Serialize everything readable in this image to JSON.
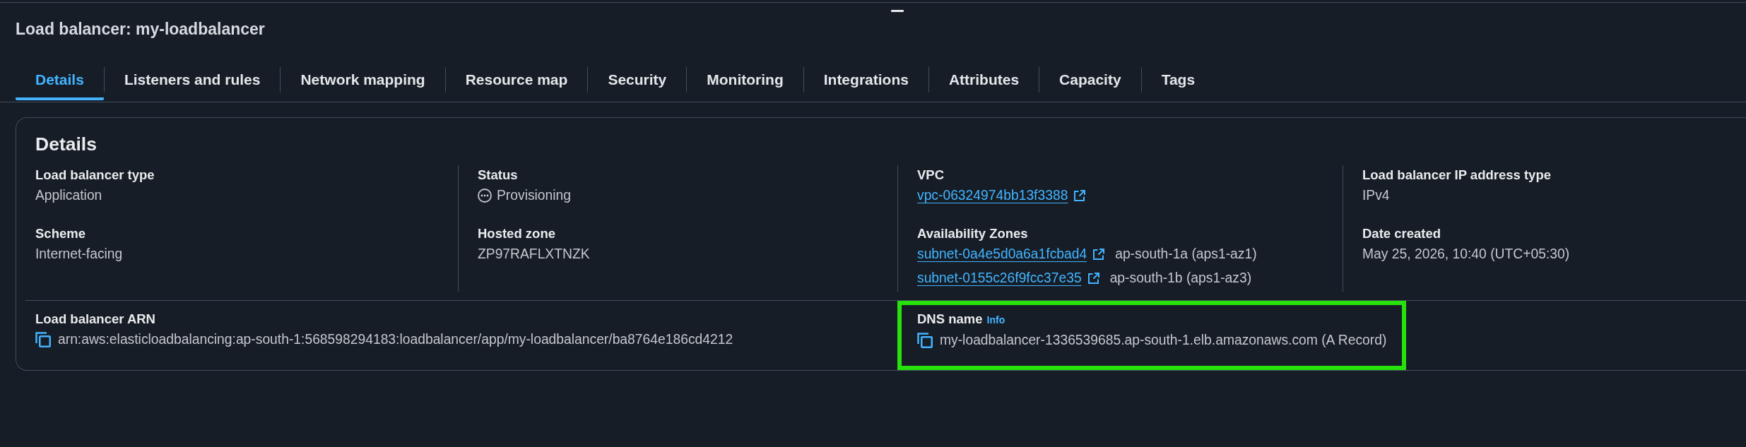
{
  "header": {
    "title": "Load balancer: my-loadbalancer"
  },
  "tabs": [
    {
      "label": "Details",
      "selected": true
    },
    {
      "label": "Listeners and rules",
      "selected": false
    },
    {
      "label": "Network mapping",
      "selected": false
    },
    {
      "label": "Resource map",
      "selected": false
    },
    {
      "label": "Security",
      "selected": false
    },
    {
      "label": "Monitoring",
      "selected": false
    },
    {
      "label": "Integrations",
      "selected": false
    },
    {
      "label": "Attributes",
      "selected": false
    },
    {
      "label": "Capacity",
      "selected": false
    },
    {
      "label": "Tags",
      "selected": false
    }
  ],
  "details": {
    "heading": "Details",
    "columns": [
      [
        {
          "label": "Load balancer type",
          "values": [
            {
              "kind": "text",
              "text": "Application"
            }
          ]
        },
        {
          "label": "Scheme",
          "values": [
            {
              "kind": "text",
              "text": "Internet-facing"
            }
          ]
        }
      ],
      [
        {
          "label": "Status",
          "values": [
            {
              "kind": "status",
              "pending": true,
              "text": "Provisioning"
            }
          ]
        },
        {
          "label": "Hosted zone",
          "values": [
            {
              "kind": "text",
              "text": "ZP97RAFLXTNZK"
            }
          ]
        }
      ],
      [
        {
          "label": "VPC",
          "values": [
            {
              "kind": "link",
              "text": "vpc-06324974bb13f3388"
            }
          ]
        },
        {
          "label": "Availability Zones",
          "values": [
            {
              "kind": "link",
              "text": "subnet-0a4e5d0a6a1fcbad4",
              "note": "ap-south-1a (aps1-az1)"
            },
            {
              "kind": "link",
              "text": "subnet-0155c26f9fcc37e35",
              "note": "ap-south-1b (aps1-az3)"
            }
          ]
        }
      ],
      [
        {
          "label": "Load balancer IP address type",
          "values": [
            {
              "kind": "text",
              "text": "IPv4"
            }
          ]
        },
        {
          "label": "Date created",
          "values": [
            {
              "kind": "text",
              "text": "May 25, 2026, 10:40 (UTC+05:30)"
            }
          ]
        }
      ]
    ],
    "footer": [
      {
        "label": "Load balancer ARN",
        "highlighted": false,
        "values": [
          {
            "kind": "copy",
            "text": "arn:aws:elasticloadbalancing:ap-south-1:568598294183:loadbalancer/app/my-loadbalancer/ba8764e186cd4212"
          }
        ]
      },
      {
        "label": "DNS name",
        "info": "Info",
        "highlighted": true,
        "values": [
          {
            "kind": "copy",
            "text": "my-loadbalancer-1336539685.ap-south-1.elb.amazonaws.com (A Record)"
          }
        ]
      }
    ]
  }
}
